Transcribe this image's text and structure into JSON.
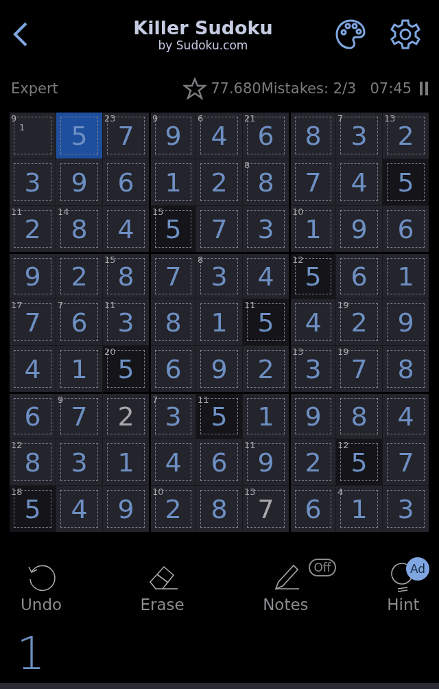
{
  "header": {
    "title": "Killer Sudoku",
    "subtitle": "by Sudoku.com"
  },
  "status": {
    "difficulty": "Expert",
    "score": "77.680",
    "mistakes": "Mistakes: 2/3",
    "timer": "07:45"
  },
  "grid": [
    [
      {
        "cage": "9",
        "note": "1",
        "selected": false,
        "same": false
      },
      {
        "value": "5",
        "given": false,
        "selected": true,
        "same": false
      },
      {
        "cage": "23",
        "value": "7",
        "given": false,
        "selected": false,
        "same": false
      },
      {
        "cage": "9",
        "value": "9",
        "given": false,
        "selected": false,
        "same": false
      },
      {
        "cage": "6",
        "value": "4",
        "given": false,
        "selected": false,
        "same": false
      },
      {
        "cage": "21",
        "value": "6",
        "given": false,
        "selected": false,
        "same": false
      },
      {
        "value": "8",
        "given": false,
        "selected": false,
        "same": false
      },
      {
        "cage": "7",
        "value": "3",
        "given": false,
        "selected": false,
        "same": false
      },
      {
        "cage": "13",
        "value": "2",
        "given": false,
        "selected": false,
        "same": false
      }
    ],
    [
      {
        "value": "3",
        "given": false,
        "selected": false,
        "same": false
      },
      {
        "value": "9",
        "given": false,
        "selected": false,
        "same": false
      },
      {
        "value": "6",
        "given": false,
        "selected": false,
        "same": false
      },
      {
        "value": "1",
        "given": false,
        "selected": false,
        "same": false
      },
      {
        "value": "2",
        "given": false,
        "selected": false,
        "same": false
      },
      {
        "cage": "8",
        "value": "8",
        "given": false,
        "selected": false,
        "same": false
      },
      {
        "value": "7",
        "given": false,
        "selected": false,
        "same": false
      },
      {
        "value": "4",
        "given": false,
        "selected": false,
        "same": false
      },
      {
        "value": "5",
        "given": false,
        "selected": false,
        "same": true
      }
    ],
    [
      {
        "cage": "11",
        "value": "2",
        "given": false,
        "selected": false,
        "same": false
      },
      {
        "cage": "14",
        "value": "8",
        "given": false,
        "selected": false,
        "same": false
      },
      {
        "value": "4",
        "given": false,
        "selected": false,
        "same": false
      },
      {
        "cage": "15",
        "value": "5",
        "given": false,
        "selected": false,
        "same": true
      },
      {
        "value": "7",
        "given": false,
        "selected": false,
        "same": false
      },
      {
        "value": "3",
        "given": false,
        "selected": false,
        "same": false
      },
      {
        "cage": "10",
        "value": "1",
        "given": false,
        "selected": false,
        "same": false
      },
      {
        "value": "9",
        "given": false,
        "selected": false,
        "same": false
      },
      {
        "value": "6",
        "given": false,
        "selected": false,
        "same": false
      }
    ],
    [
      {
        "value": "9",
        "given": false,
        "selected": false,
        "same": false
      },
      {
        "value": "2",
        "given": false,
        "selected": false,
        "same": false
      },
      {
        "cage": "15",
        "value": "8",
        "given": false,
        "selected": false,
        "same": false
      },
      {
        "value": "7",
        "given": false,
        "selected": false,
        "same": false
      },
      {
        "cage": "8",
        "value": "3",
        "given": false,
        "selected": false,
        "same": false
      },
      {
        "value": "4",
        "given": false,
        "selected": false,
        "same": false
      },
      {
        "cage": "12",
        "value": "5",
        "given": false,
        "selected": false,
        "same": true
      },
      {
        "value": "6",
        "given": false,
        "selected": false,
        "same": false
      },
      {
        "value": "1",
        "given": false,
        "selected": false,
        "same": false
      }
    ],
    [
      {
        "cage": "17",
        "value": "7",
        "given": false,
        "selected": false,
        "same": false
      },
      {
        "cage": "7",
        "value": "6",
        "given": false,
        "selected": false,
        "same": false
      },
      {
        "cage": "11",
        "value": "3",
        "given": false,
        "selected": false,
        "same": false
      },
      {
        "value": "8",
        "given": false,
        "selected": false,
        "same": false
      },
      {
        "value": "1",
        "given": false,
        "selected": false,
        "same": false
      },
      {
        "cage": "11",
        "value": "5",
        "given": false,
        "selected": false,
        "same": true
      },
      {
        "value": "4",
        "given": false,
        "selected": false,
        "same": false
      },
      {
        "cage": "19",
        "value": "2",
        "given": false,
        "selected": false,
        "same": false
      },
      {
        "value": "9",
        "given": false,
        "selected": false,
        "same": false
      }
    ],
    [
      {
        "value": "4",
        "given": false,
        "selected": false,
        "same": false
      },
      {
        "value": "1",
        "given": false,
        "selected": false,
        "same": false
      },
      {
        "cage": "20",
        "value": "5",
        "given": false,
        "selected": false,
        "same": true
      },
      {
        "value": "6",
        "given": false,
        "selected": false,
        "same": false
      },
      {
        "value": "9",
        "given": false,
        "selected": false,
        "same": false
      },
      {
        "value": "2",
        "given": false,
        "selected": false,
        "same": false
      },
      {
        "cage": "13",
        "value": "3",
        "given": false,
        "selected": false,
        "same": false
      },
      {
        "cage": "19",
        "value": "7",
        "given": false,
        "selected": false,
        "same": false
      },
      {
        "value": "8",
        "given": false,
        "selected": false,
        "same": false
      }
    ],
    [
      {
        "value": "6",
        "given": false,
        "selected": false,
        "same": false
      },
      {
        "cage": "9",
        "value": "7",
        "given": false,
        "selected": false,
        "same": false
      },
      {
        "value": "2",
        "given": true,
        "selected": false,
        "same": false
      },
      {
        "cage": "7",
        "value": "3",
        "given": false,
        "selected": false,
        "same": false
      },
      {
        "cage": "11",
        "value": "5",
        "given": false,
        "selected": false,
        "same": true
      },
      {
        "value": "1",
        "given": false,
        "selected": false,
        "same": false
      },
      {
        "value": "9",
        "given": false,
        "selected": false,
        "same": false
      },
      {
        "value": "8",
        "given": false,
        "selected": false,
        "same": false
      },
      {
        "value": "4",
        "given": false,
        "selected": false,
        "same": false
      }
    ],
    [
      {
        "cage": "12",
        "value": "8",
        "given": false,
        "selected": false,
        "same": false
      },
      {
        "value": "3",
        "given": false,
        "selected": false,
        "same": false
      },
      {
        "value": "1",
        "given": false,
        "selected": false,
        "same": false
      },
      {
        "value": "4",
        "given": false,
        "selected": false,
        "same": false
      },
      {
        "value": "6",
        "given": false,
        "selected": false,
        "same": false
      },
      {
        "cage": "11",
        "value": "9",
        "given": false,
        "selected": false,
        "same": false
      },
      {
        "value": "2",
        "given": false,
        "selected": false,
        "same": false
      },
      {
        "cage": "12",
        "value": "5",
        "given": false,
        "selected": false,
        "same": true
      },
      {
        "value": "7",
        "given": false,
        "selected": false,
        "same": false
      }
    ],
    [
      {
        "cage": "18",
        "value": "5",
        "given": false,
        "selected": false,
        "same": true
      },
      {
        "value": "4",
        "given": false,
        "selected": false,
        "same": false
      },
      {
        "value": "9",
        "given": false,
        "selected": false,
        "same": false
      },
      {
        "cage": "10",
        "value": "2",
        "given": false,
        "selected": false,
        "same": false
      },
      {
        "value": "8",
        "given": false,
        "selected": false,
        "same": false
      },
      {
        "cage": "13",
        "value": "7",
        "given": true,
        "selected": false,
        "same": false
      },
      {
        "value": "6",
        "given": false,
        "selected": false,
        "same": false
      },
      {
        "cage": "4",
        "value": "1",
        "given": false,
        "selected": false,
        "same": false
      },
      {
        "value": "3",
        "given": false,
        "selected": false,
        "same": false
      }
    ]
  ],
  "tools": [
    {
      "kind": "undo",
      "label": "Undo"
    },
    {
      "kind": "erase",
      "label": "Erase"
    },
    {
      "kind": "notes",
      "label": "Notes",
      "badge": "Off"
    },
    {
      "kind": "hint",
      "label": "Hint",
      "badge": "Ad"
    }
  ],
  "number_pad": [
    "1"
  ]
}
